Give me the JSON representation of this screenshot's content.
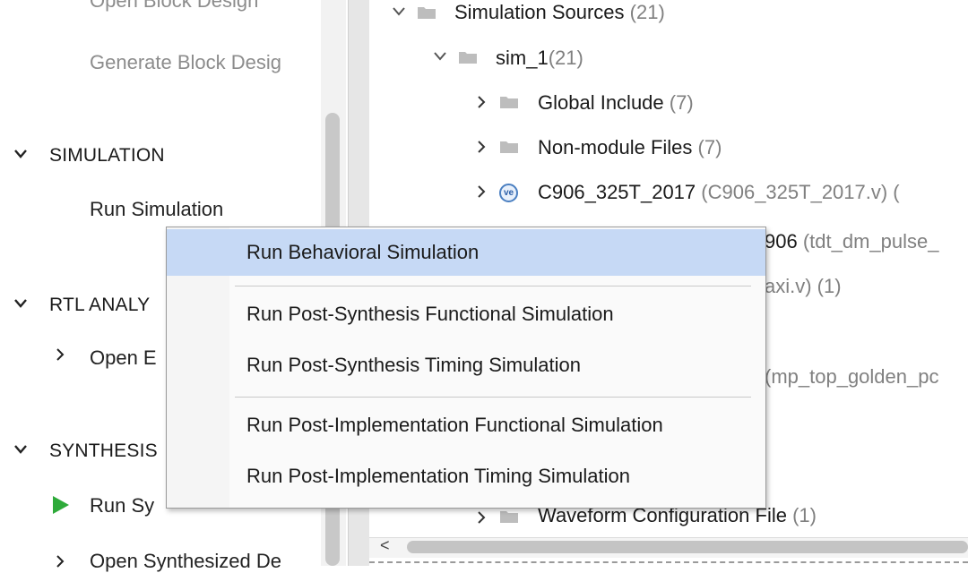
{
  "flow_navigator": {
    "open_block_design": "Open Block Design",
    "generate_block_design": "Generate Block Desig",
    "simulation": {
      "title": "SIMULATION",
      "run_simulation": "Run Simulation"
    },
    "rtl_analysis": {
      "title": "RTL ANALY",
      "open_elaborated": "Open E"
    },
    "synthesis": {
      "title": "SYNTHESIS",
      "run_synthesis": "Run Sy",
      "open_synthesized": "Open Synthesized De"
    }
  },
  "sources_tree": {
    "simulation_sources": {
      "label": "Simulation Sources",
      "count": "(21)"
    },
    "sim_1": {
      "label": "sim_1",
      "count": "(21)"
    },
    "global_include": {
      "label": "Global Include",
      "count": "(7)"
    },
    "non_module_files": {
      "label": "Non-module Files",
      "count": "(7)"
    },
    "c906_module": {
      "label": "C906_325T_2017",
      "file": "(C906_325T_2017.v) ("
    },
    "row_partial_1": {
      "label": "906",
      "file": "(tdt_dm_pulse_"
    },
    "row_partial_2": {
      "file": "axi.v) (1)"
    },
    "row_partial_3": {
      "file": "(mp_top_golden_pc"
    },
    "waveform_config": {
      "label": "Waveform Configuration File",
      "count": "(1)"
    },
    "scroll_left_arrow": "<"
  },
  "context_menu": {
    "items": [
      "Run Behavioral Simulation",
      "Run Post-Synthesis Functional Simulation",
      "Run Post-Synthesis Timing Simulation",
      "Run Post-Implementation Functional Simulation",
      "Run Post-Implementation Timing Simulation"
    ]
  },
  "colors": {
    "highlight": "#c6d9f5",
    "run_green": "#2eaa3a",
    "count_gray": "#808080",
    "ve_icon_blue": "#4a7fc1"
  },
  "icons": [
    "chevron-down-icon",
    "chevron-right-icon",
    "folder-icon",
    "verilog-module-icon",
    "play-icon"
  ]
}
